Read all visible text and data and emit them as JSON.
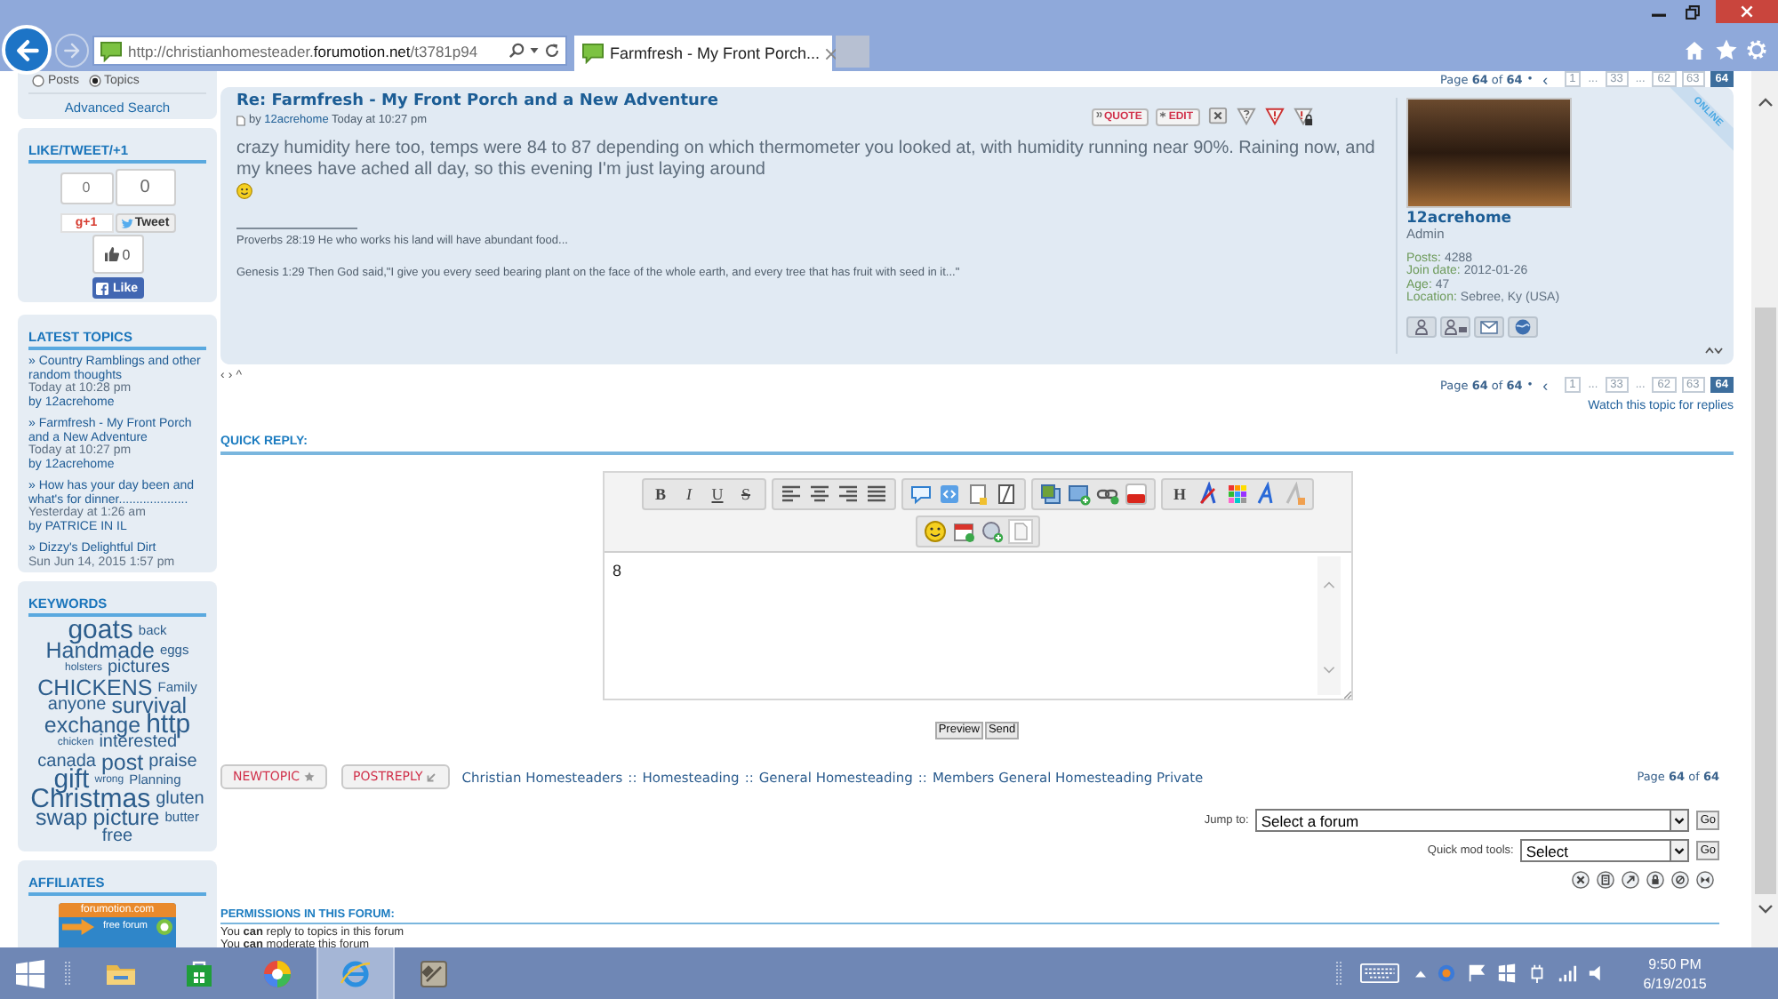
{
  "browser": {
    "address": "http://christianhomesteader.**forumotion.net**/t3781p94",
    "tab_title": "Farmfresh - My Front Porch..."
  },
  "sidebar": {
    "search_scope": [
      {
        "label": "Posts",
        "selected": false
      },
      {
        "label": "Topics",
        "selected": true
      }
    ],
    "advanced_search": "Advanced Search",
    "like_box": {
      "title": "LIKE/TWEET/+1",
      "share_counts": [
        "0",
        "0"
      ],
      "plus_one": "g+1",
      "tweet": "Tweet",
      "like_count": "0",
      "like": "Like"
    },
    "latest_topics": {
      "title": "LATEST TOPICS",
      "items": [
        {
          "topic": "» Country Ramblings and other random thoughts",
          "time": "Today at 10:28 pm",
          "byline": "by 12acrehome"
        },
        {
          "topic": "» Farmfresh - My Front Porch and a New Adventure",
          "time": "Today at 10:27 pm",
          "byline": "by 12acrehome"
        },
        {
          "topic": "» How has your day been and what's for dinner....................",
          "time": "Yesterday at 1:26 am",
          "byline": "by PATRICE IN IL"
        },
        {
          "topic": "» Dizzy's Delightful Dirt",
          "time": "Sun Jun 14, 2015 1:57 pm"
        }
      ]
    },
    "keywords": {
      "title": "KEYWORDS",
      "tags": [
        {
          "word": "goats",
          "kind": "xl"
        },
        {
          "word": "back",
          "kind": "sm"
        },
        {
          "word": "Handmade",
          "kind": "lg"
        },
        {
          "word": "eggs",
          "kind": "sm"
        },
        {
          "word": "holsters",
          "kind": "xs"
        },
        {
          "word": "pictures",
          "kind": "md"
        },
        {
          "word": "CHICKENS",
          "kind": "lg"
        },
        {
          "word": "Family",
          "kind": "sm"
        },
        {
          "word": "anyone",
          "kind": "md"
        },
        {
          "word": "survival",
          "kind": "lg"
        },
        {
          "word": "exchange",
          "kind": "lg"
        },
        {
          "word": "http",
          "kind": "xl"
        },
        {
          "word": "chicken",
          "kind": "xs"
        },
        {
          "word": "interested",
          "kind": "md"
        },
        {
          "word": "canada",
          "kind": "md"
        },
        {
          "word": "post",
          "kind": "lg"
        },
        {
          "word": "praise",
          "kind": "md"
        },
        {
          "word": "gift",
          "kind": "xl"
        },
        {
          "word": "wrong",
          "kind": "xs"
        },
        {
          "word": "Planning",
          "kind": "sm"
        },
        {
          "word": "Christmas",
          "kind": "xl"
        },
        {
          "word": "gluten",
          "kind": "md"
        },
        {
          "word": "swap",
          "kind": "lg"
        },
        {
          "word": "picture",
          "kind": "lg"
        },
        {
          "word": "butter",
          "kind": "sm"
        },
        {
          "word": "free",
          "kind": "md"
        }
      ]
    },
    "affiliates": {
      "title": "AFFILIATES",
      "banner_title": "forumotion.com",
      "banner_caption": "free forum"
    }
  },
  "topic": {
    "pagination_top": {
      "summary": "Page **64** of **64**",
      "bullet": "•",
      "prev": "‹",
      "pages": [
        {
          "label": "1",
          "kind": "page",
          "selected": false
        },
        {
          "label": "...",
          "kind": "gap",
          "selected": false
        },
        {
          "label": "33",
          "kind": "page",
          "selected": false
        },
        {
          "label": "...",
          "kind": "gap",
          "selected": false
        },
        {
          "label": "62",
          "kind": "page",
          "selected": false
        },
        {
          "label": "63",
          "kind": "page",
          "selected": false
        },
        {
          "label": "64",
          "kind": "page",
          "selected": true
        }
      ]
    },
    "post": {
      "title": "Re: Farmfresh - My Front Porch and a New Adventure",
      "byline": "by **12acrehome** Today at 10:27 pm",
      "actions": [
        "QUOTE",
        "EDIT"
      ],
      "body": "crazy humidity here too, temps were 84 to 87 depending on which thermometer you looked at, with humidity running near 90%. Raining now, and my knees have ached all day, so this evening I'm just laying around",
      "signature": [
        "Proverbs 28:19 He who works his land will have abundant food...",
        "Genesis 1:29 Then God said,\"I give you every seed bearing plant on the face of the whole earth, and every tree that has fruit with seed in it...\""
      ],
      "author": {
        "name": "12acrehome",
        "rank": "Admin",
        "stats": [
          {
            "label": "Posts:",
            "value": "4288"
          },
          {
            "label": "Join date:",
            "value": "2012-01-26"
          },
          {
            "label": "Age:",
            "value": "47"
          },
          {
            "label": "Location:",
            "value": "Sebree, Ky (USA)"
          }
        ],
        "status": "ONLINE"
      }
    },
    "post_nav": [
      "‹",
      "›",
      "^"
    ],
    "pagination_bottom": {
      "summary": "Page **64** of **64**",
      "bullet": "•",
      "prev": "‹",
      "pages": [
        {
          "label": "1",
          "kind": "page",
          "selected": false
        },
        {
          "label": "...",
          "kind": "gap",
          "selected": false
        },
        {
          "label": "33",
          "kind": "page",
          "selected": false
        },
        {
          "label": "...",
          "kind": "gap",
          "selected": false
        },
        {
          "label": "62",
          "kind": "page",
          "selected": false
        },
        {
          "label": "63",
          "kind": "page",
          "selected": false
        },
        {
          "label": "64",
          "kind": "page",
          "selected": true
        }
      ]
    },
    "watch": "Watch this topic for replies"
  },
  "quick_reply": {
    "title": "QUICK REPLY:",
    "format_buttons": [
      "B",
      "I",
      "U",
      "S"
    ],
    "heading_button": "H",
    "message": "8",
    "actions": [
      "Preview",
      "Send"
    ]
  },
  "footer": {
    "new_topic": "NEWTOPIC",
    "post_reply": "POSTREPLY",
    "breadcrumb": [
      {
        "label": "Christian Homesteaders",
        "separator": "::"
      },
      {
        "label": "Homesteading",
        "separator": "::"
      },
      {
        "label": "General Homesteading",
        "separator": "::"
      },
      {
        "label": "Members General Homesteading Private"
      }
    ],
    "page_summary": "Page **64** of **64**",
    "jump_to": {
      "label": "Jump to:",
      "value": "Select a forum",
      "button": "Go"
    },
    "quick_mod": {
      "label": "Quick mod tools:",
      "value": "Select",
      "button": "Go"
    },
    "permissions": {
      "title": "PERMISSIONS IN THIS FORUM:",
      "lines": [
        "You **can** reply to topics in this forum",
        "You **can** moderate this forum"
      ]
    }
  },
  "taskbar": {
    "apps": [
      {
        "kind": "folder",
        "active": false
      },
      {
        "kind": "store",
        "active": false
      },
      {
        "kind": "color_wheel",
        "active": false
      },
      {
        "kind": "browser",
        "active": true
      },
      {
        "kind": "tool",
        "active": false
      }
    ],
    "time": "9:50 PM",
    "date": "6/19/2015"
  }
}
